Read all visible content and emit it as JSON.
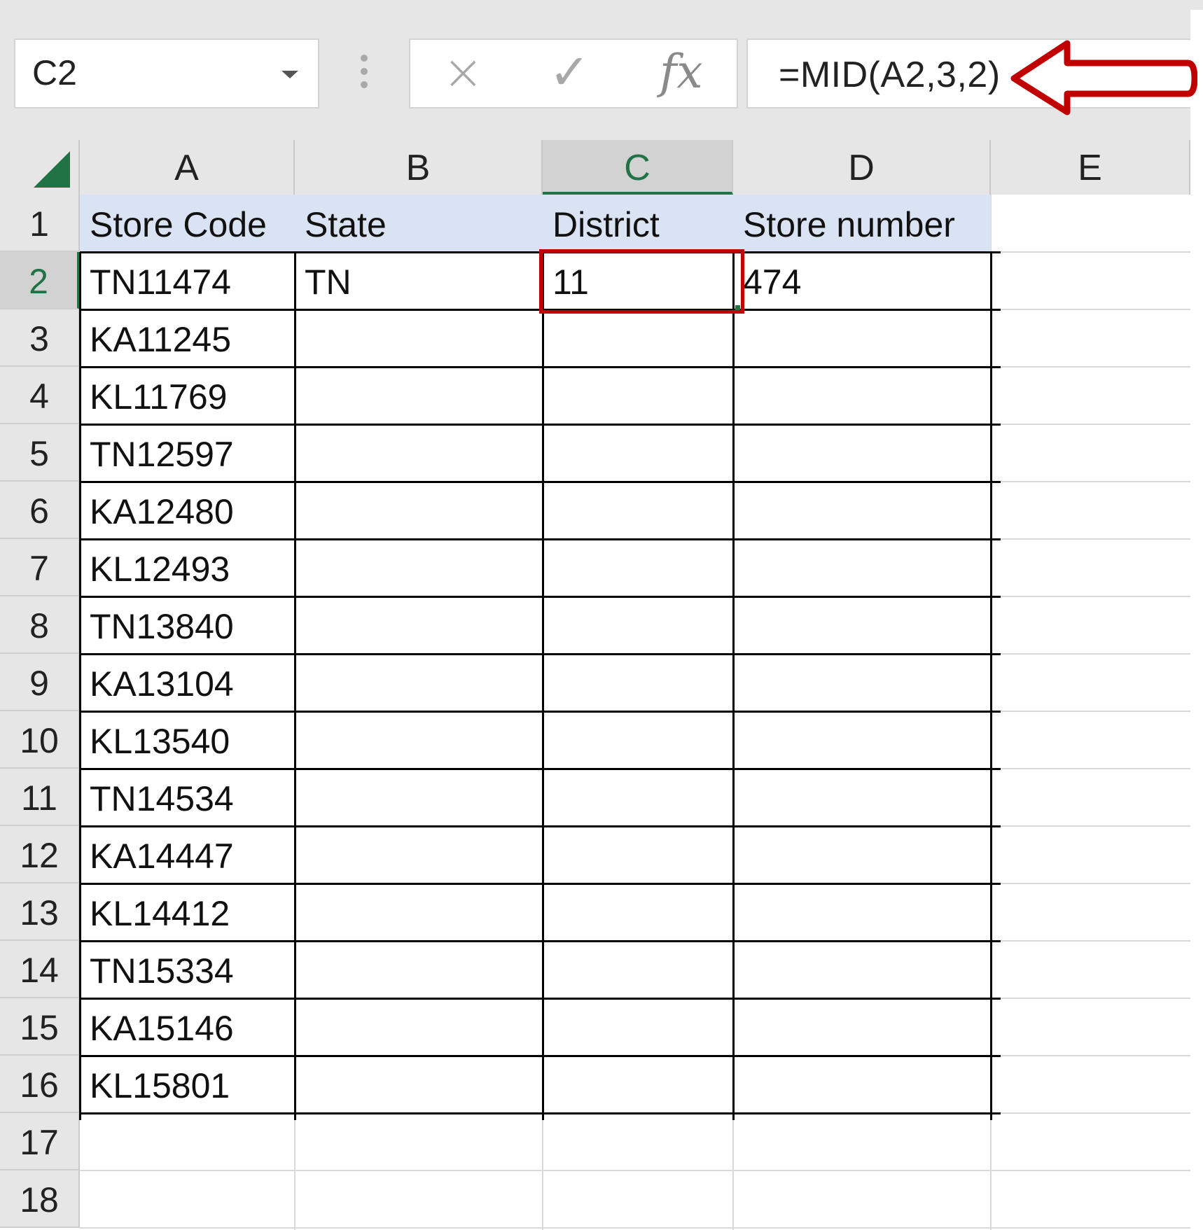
{
  "name_box": {
    "value": "C2"
  },
  "formula_bar": {
    "cancel_icon": "×",
    "enter_icon": "✓",
    "function_icon": "fx",
    "formula": "=MID(A2,3,2)"
  },
  "columns": [
    "A",
    "B",
    "C",
    "D",
    "E"
  ],
  "selected_column": "C",
  "selected_row": "2",
  "rows": [
    "1",
    "2",
    "3",
    "4",
    "5",
    "6",
    "7",
    "8",
    "9",
    "10",
    "11",
    "12",
    "13",
    "14",
    "15",
    "16",
    "17",
    "18"
  ],
  "table": {
    "headers": [
      "Store Code",
      "State",
      "District",
      "Store number"
    ],
    "rows": [
      [
        "TN11474",
        "TN",
        "11",
        "474"
      ],
      [
        "KA11245",
        "",
        "",
        ""
      ],
      [
        "KL11769",
        "",
        "",
        ""
      ],
      [
        "TN12597",
        "",
        "",
        ""
      ],
      [
        "KA12480",
        "",
        "",
        ""
      ],
      [
        "KL12493",
        "",
        "",
        ""
      ],
      [
        "TN13840",
        "",
        "",
        ""
      ],
      [
        "KA13104",
        "",
        "",
        ""
      ],
      [
        "KL13540",
        "",
        "",
        ""
      ],
      [
        "TN14534",
        "",
        "",
        ""
      ],
      [
        "KA14447",
        "",
        "",
        ""
      ],
      [
        "KL14412",
        "",
        "",
        ""
      ],
      [
        "TN15334",
        "",
        "",
        ""
      ],
      [
        "KA15146",
        "",
        "",
        ""
      ],
      [
        "KL15801",
        "",
        "",
        ""
      ]
    ]
  },
  "colors": {
    "header_fill": "#dae3f3",
    "selection_green": "#217346",
    "highlight_red": "#c00000"
  }
}
